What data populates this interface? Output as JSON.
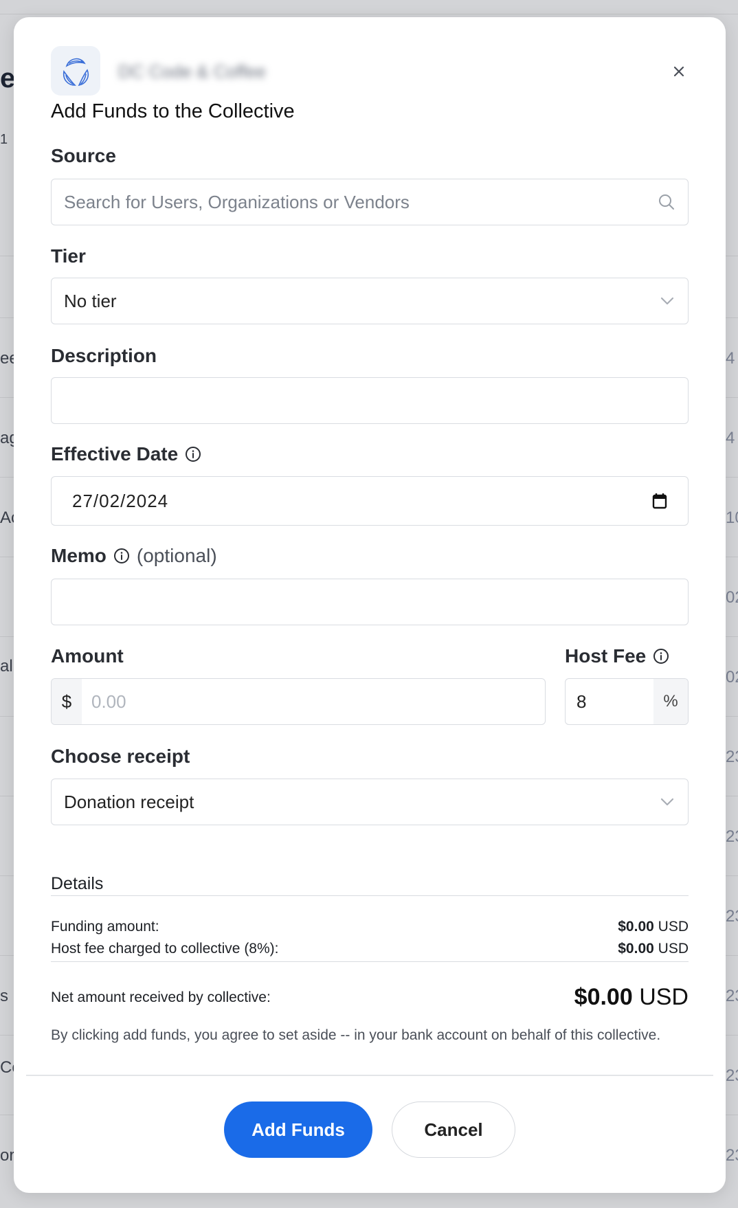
{
  "background": {
    "left_fragments": [
      "es",
      "1",
      "ee",
      "ag",
      "Ac",
      "al",
      "s",
      "Co",
      "or"
    ],
    "right_fragments": [
      "4",
      "4",
      "10",
      "02",
      "02",
      "23",
      "23",
      "23",
      "23",
      "23",
      "23"
    ]
  },
  "modal": {
    "collective_name": "DC Code & Coffee",
    "title": "Add Funds to the Collective"
  },
  "form": {
    "source": {
      "label": "Source",
      "placeholder": "Search for Users, Organizations or Vendors"
    },
    "tier": {
      "label": "Tier",
      "value": "No tier"
    },
    "description": {
      "label": "Description",
      "value": ""
    },
    "effective_date": {
      "label": "Effective Date",
      "value": "27/02/2024"
    },
    "memo": {
      "label": "Memo",
      "optional": "(optional)",
      "value": ""
    },
    "amount": {
      "label": "Amount",
      "currency_symbol": "$",
      "placeholder": "0.00"
    },
    "host_fee": {
      "label": "Host Fee",
      "value": "8",
      "suffix": "%"
    },
    "receipt": {
      "label": "Choose receipt",
      "value": "Donation receipt"
    }
  },
  "details": {
    "title": "Details",
    "funding_label": "Funding amount:",
    "funding_value": "$0.00",
    "funding_currency": "USD",
    "host_fee_label": "Host fee charged to collective (8%):",
    "host_fee_value": "$0.00",
    "host_fee_currency": "USD",
    "net_label": "Net amount received by collective:",
    "net_value": "$0.00",
    "net_currency": "USD",
    "disclaimer": "By clicking add funds, you agree to set aside -- in your bank account on behalf of this collective."
  },
  "buttons": {
    "add_funds": "Add Funds",
    "cancel": "Cancel"
  },
  "colors": {
    "primary": "#1a6be8",
    "overlay": "#d3d4d7"
  }
}
